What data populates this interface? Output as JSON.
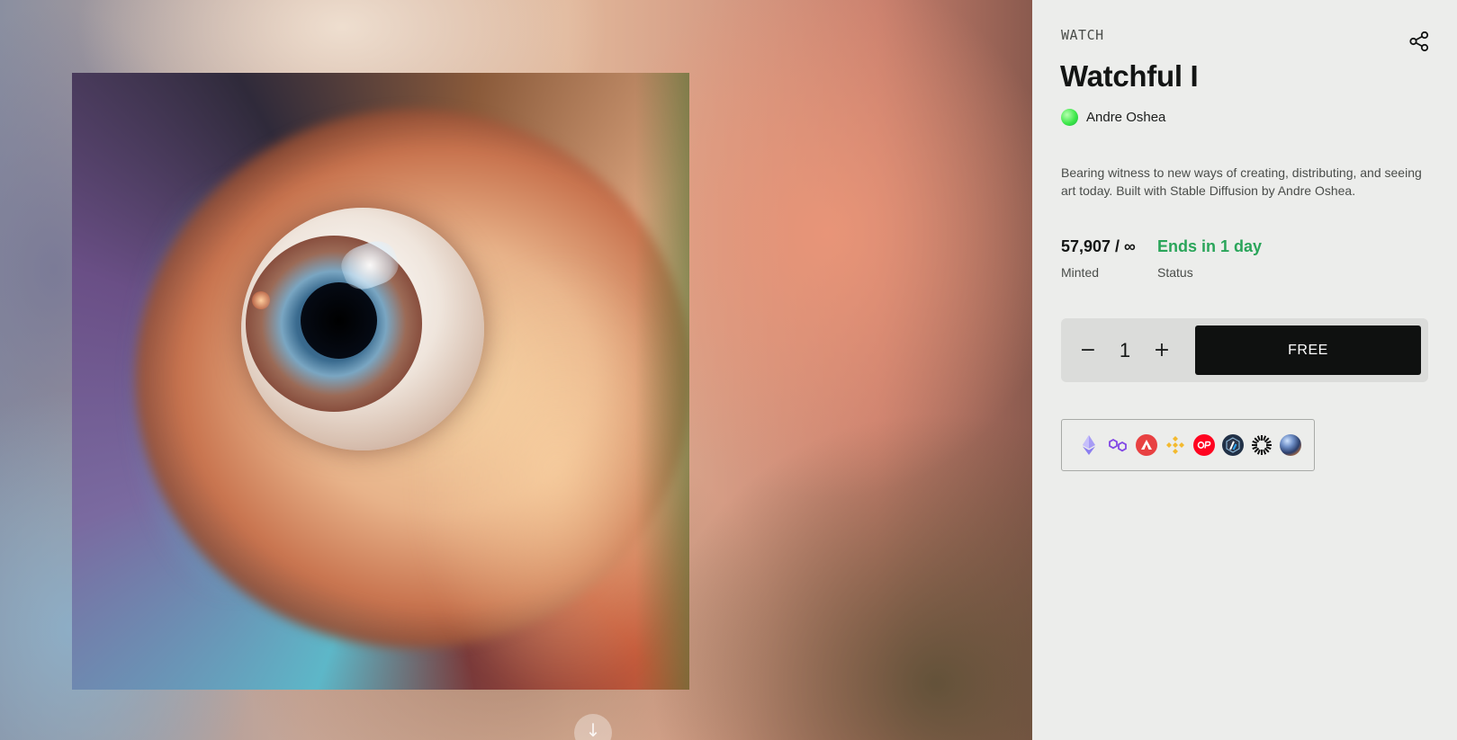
{
  "artwork": {
    "alt_icon": "eye-artwork",
    "scroll_icon": "arrow-down-icon",
    "scroll_symbol": "↓"
  },
  "panel": {
    "eyebrow": "WATCH",
    "title": "Watchful I",
    "share_icon": "share-icon",
    "author": {
      "name": "Andre Oshea",
      "avatar_color": "#3ee84a"
    },
    "description": "Bearing witness to new ways of creating, distributing, and seeing art today. Built with Stable Diffusion by Andre Oshea.",
    "stats": {
      "minted_value": "57,907 / ∞",
      "minted_label": "Minted",
      "status_value": "Ends in 1 day",
      "status_label": "Status",
      "status_color": "#2aa55a"
    },
    "mint": {
      "minus_symbol": "−",
      "quantity": "1",
      "plus_symbol": "+",
      "button_label": "FREE"
    },
    "chains": [
      {
        "icon": "ethereum-icon",
        "color": "#8c7ff0"
      },
      {
        "icon": "polygon-icon",
        "color": "#8247e5"
      },
      {
        "icon": "avalanche-icon",
        "color": "#e84142"
      },
      {
        "icon": "bnb-icon",
        "color": "#f3ba2f"
      },
      {
        "icon": "optimism-icon",
        "color": "#ff0420",
        "text": "OP"
      },
      {
        "icon": "arbitrum-icon",
        "color": "#213147"
      },
      {
        "icon": "zora-sunburst-icon",
        "color": "#111111"
      },
      {
        "icon": "zora-orb-icon",
        "color": "#2b3e6b"
      }
    ]
  }
}
